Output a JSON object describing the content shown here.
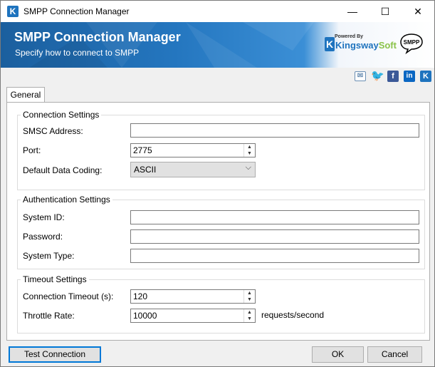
{
  "window": {
    "title": "SMPP Connection Manager",
    "minimize": "—",
    "maximize": "☐",
    "close": "✕"
  },
  "banner": {
    "title": "SMPP Connection Manager",
    "subtitle": "Specify how to connect to SMPP",
    "powered_by": "Powered By",
    "brand_a": "Kingsway",
    "brand_b": "Soft",
    "smpp_logo": "SMPP"
  },
  "social": [
    "email-icon",
    "twitter-icon",
    "facebook-icon",
    "linkedin-icon",
    "kingswaysoft-icon"
  ],
  "tabs": [
    {
      "label": "General",
      "selected": true
    }
  ],
  "connection": {
    "title": "Connection Settings",
    "smsc_label": "SMSC Address:",
    "smsc_value": "",
    "port_label": "Port:",
    "port_value": "2775",
    "coding_label": "Default Data Coding:",
    "coding_value": "ASCII"
  },
  "auth": {
    "title": "Authentication Settings",
    "system_id_label": "System ID:",
    "system_id_value": "",
    "password_label": "Password:",
    "password_value": "",
    "system_type_label": "System Type:",
    "system_type_value": ""
  },
  "timeout": {
    "title": "Timeout Settings",
    "conn_timeout_label": "Connection Timeout (s):",
    "conn_timeout_value": "120",
    "throttle_label": "Throttle Rate:",
    "throttle_value": "10000",
    "throttle_unit": "requests/second"
  },
  "buttons": {
    "test": "Test Connection",
    "ok": "OK",
    "cancel": "Cancel"
  },
  "colors": {
    "banner": "#2476bf",
    "brand_blue": "#1e73be",
    "brand_green": "#8bc34a",
    "focus": "#0078d7"
  }
}
